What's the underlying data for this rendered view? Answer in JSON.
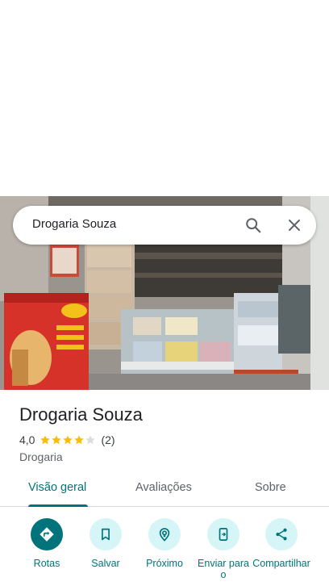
{
  "search": {
    "query": "Drogaria Souza"
  },
  "place": {
    "name": "Drogaria Souza",
    "rating": "4,0",
    "stars": 4,
    "reviews": "(2)",
    "category": "Drogaria"
  },
  "tabs": [
    {
      "label": "Visão geral",
      "active": true
    },
    {
      "label": "Avaliações",
      "active": false
    },
    {
      "label": "Sobre",
      "active": false
    }
  ],
  "actions": [
    {
      "label": "Rotas",
      "icon": "directions-icon"
    },
    {
      "label": "Salvar",
      "icon": "bookmark-icon"
    },
    {
      "label": "Próximo",
      "icon": "nearby-icon"
    },
    {
      "label": "Enviar para o ",
      "icon": "send-to-phone-icon"
    },
    {
      "label": "Compartilhar",
      "icon": "share-icon"
    }
  ],
  "colors": {
    "accent": "#00747a",
    "accent_light": "#d6f5f6",
    "star": "#fbbc04",
    "star_empty": "#dadce0"
  }
}
